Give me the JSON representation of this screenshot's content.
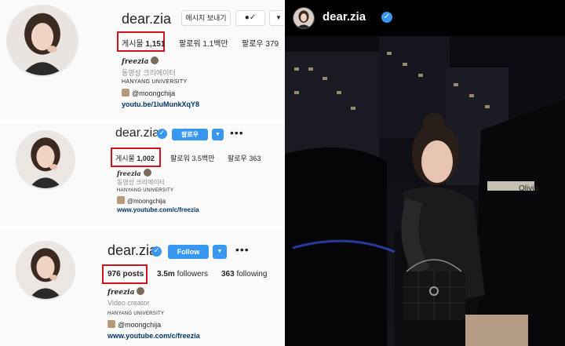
{
  "panel1": {
    "username": "dear.zia",
    "message_button": "메시지 보내기",
    "stats": {
      "posts_label": "게시물",
      "posts_count": "1,151",
      "followers": "팔로워 1.1백만",
      "following": "팔로우 379"
    },
    "bio": {
      "name": "𝒇𝒓𝒆𝒆𝒛𝒊𝒂",
      "title": "동영상 크리에이터",
      "school": "HANYANG UNIVERSITY",
      "handle": "@moongchija",
      "link": "youtu.be/1luMunkXqY8"
    }
  },
  "panel2": {
    "username": "dear.zia",
    "follow_button": "팔로우",
    "stats": {
      "posts_label": "게시물",
      "posts_count": "1,002",
      "followers": "팔로워 3.5백만",
      "following": "팔로우 363"
    },
    "bio": {
      "name": "𝒇𝒓𝒆𝒆𝒛𝒊𝒂",
      "title": "동영상 크리에이터",
      "school": "HANYANG UNIVERSITY",
      "handle": "@moongchija",
      "link": "www.youtube.com/c/freezia"
    }
  },
  "panel3": {
    "username": "dear.zia",
    "follow_button": "Follow",
    "stats": {
      "posts": "976 posts",
      "followers_count": "3.5m",
      "followers_label": "followers",
      "following_count": "363",
      "following_label": "following"
    },
    "bio": {
      "name": "𝒇𝒓𝒆𝒆𝒛𝒊𝒂",
      "title": "Video creator",
      "school": "HANYANG UNIVERSITY",
      "handle": "@moongchija",
      "link": "www.youtube.com/c/freezia"
    }
  },
  "post": {
    "username": "dear.zia",
    "sign_text": "Olivia"
  },
  "colors": {
    "highlight": "#d3141a",
    "verified": "#3897f0",
    "link": "#003569"
  }
}
